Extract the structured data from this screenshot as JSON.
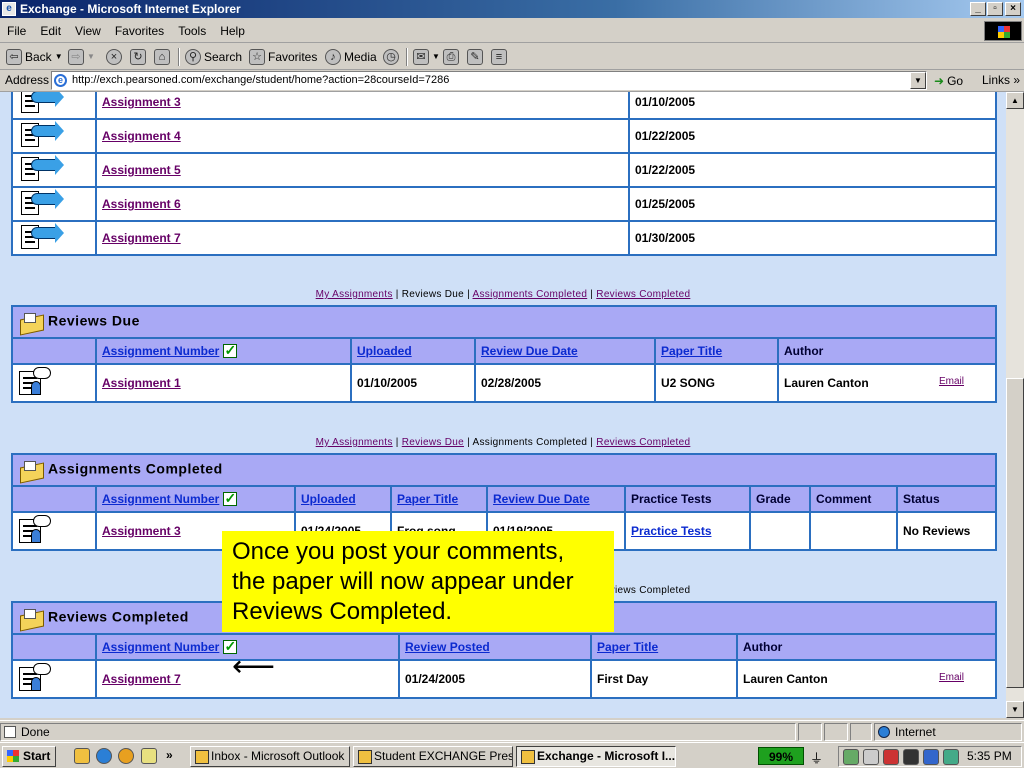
{
  "window": {
    "title": "Exchange - Microsoft Internet Explorer"
  },
  "menu": [
    "File",
    "Edit",
    "View",
    "Favorites",
    "Tools",
    "Help"
  ],
  "toolbar": {
    "back": "Back",
    "search": "Search",
    "favorites": "Favorites",
    "media": "Media"
  },
  "address": {
    "label": "Address",
    "url": "http://exch.pearsoned.com/exchange/student/home?action=28courseId=7286",
    "go": "Go",
    "links": "Links"
  },
  "my_assignments": {
    "rows": [
      {
        "name": "Assignment 3",
        "date": "01/10/2005"
      },
      {
        "name": "Assignment 4",
        "date": "01/22/2005"
      },
      {
        "name": "Assignment 5",
        "date": "01/22/2005"
      },
      {
        "name": "Assignment 6",
        "date": "01/25/2005"
      },
      {
        "name": "Assignment 7",
        "date": "01/30/2005"
      }
    ]
  },
  "nav": {
    "my_assignments": "My Assignments",
    "reviews_due": "Reviews Due",
    "assignments_completed": "Assignments Completed",
    "reviews_completed": "Reviews Completed",
    "sep": "|"
  },
  "reviews_due": {
    "title": "Reviews Due",
    "headers": {
      "assignment_number": "Assignment Number",
      "uploaded": "Uploaded",
      "review_due_date": "Review Due Date",
      "paper_title": "Paper Title",
      "author": "Author"
    },
    "row": {
      "name": "Assignment 1",
      "uploaded": "01/10/2005",
      "due": "02/28/2005",
      "paper": "U2 SONG",
      "author": "Lauren Canton",
      "email": "Email"
    }
  },
  "assignments_completed": {
    "title": "Assignments Completed",
    "headers": {
      "assignment_number": "Assignment Number",
      "uploaded": "Uploaded",
      "paper_title": "Paper Title",
      "review_due_date": "Review Due Date",
      "practice_tests": "Practice Tests",
      "grade": "Grade",
      "comment": "Comment",
      "status": "Status"
    },
    "row": {
      "name": "Assignment 3",
      "uploaded": "01/24/2005",
      "paper": "Frog song",
      "due": "01/19/2005",
      "practice": "Practice Tests",
      "grade": "",
      "comment": "",
      "status": "No Reviews"
    }
  },
  "reviews_completed": {
    "title": "Reviews Completed",
    "headers": {
      "assignment_number": "Assignment Number",
      "review_posted": "Review Posted",
      "paper_title": "Paper Title",
      "author": "Author"
    },
    "row": {
      "name": "Assignment 7",
      "posted": "01/24/2005",
      "paper": "First Day",
      "author": "Lauren Canton",
      "email": "Email"
    }
  },
  "callout": {
    "text": "Once you post your comments, the paper will now appear under Reviews Completed."
  },
  "status": {
    "text": "Done",
    "zone": "Internet"
  },
  "taskbar": {
    "start": "Start",
    "tasks": [
      "Inbox - Microsoft Outlook",
      "Student EXCHANGE Prese...",
      "Exchange - Microsoft I..."
    ],
    "battery": "99%",
    "clock": "5:35 PM"
  }
}
